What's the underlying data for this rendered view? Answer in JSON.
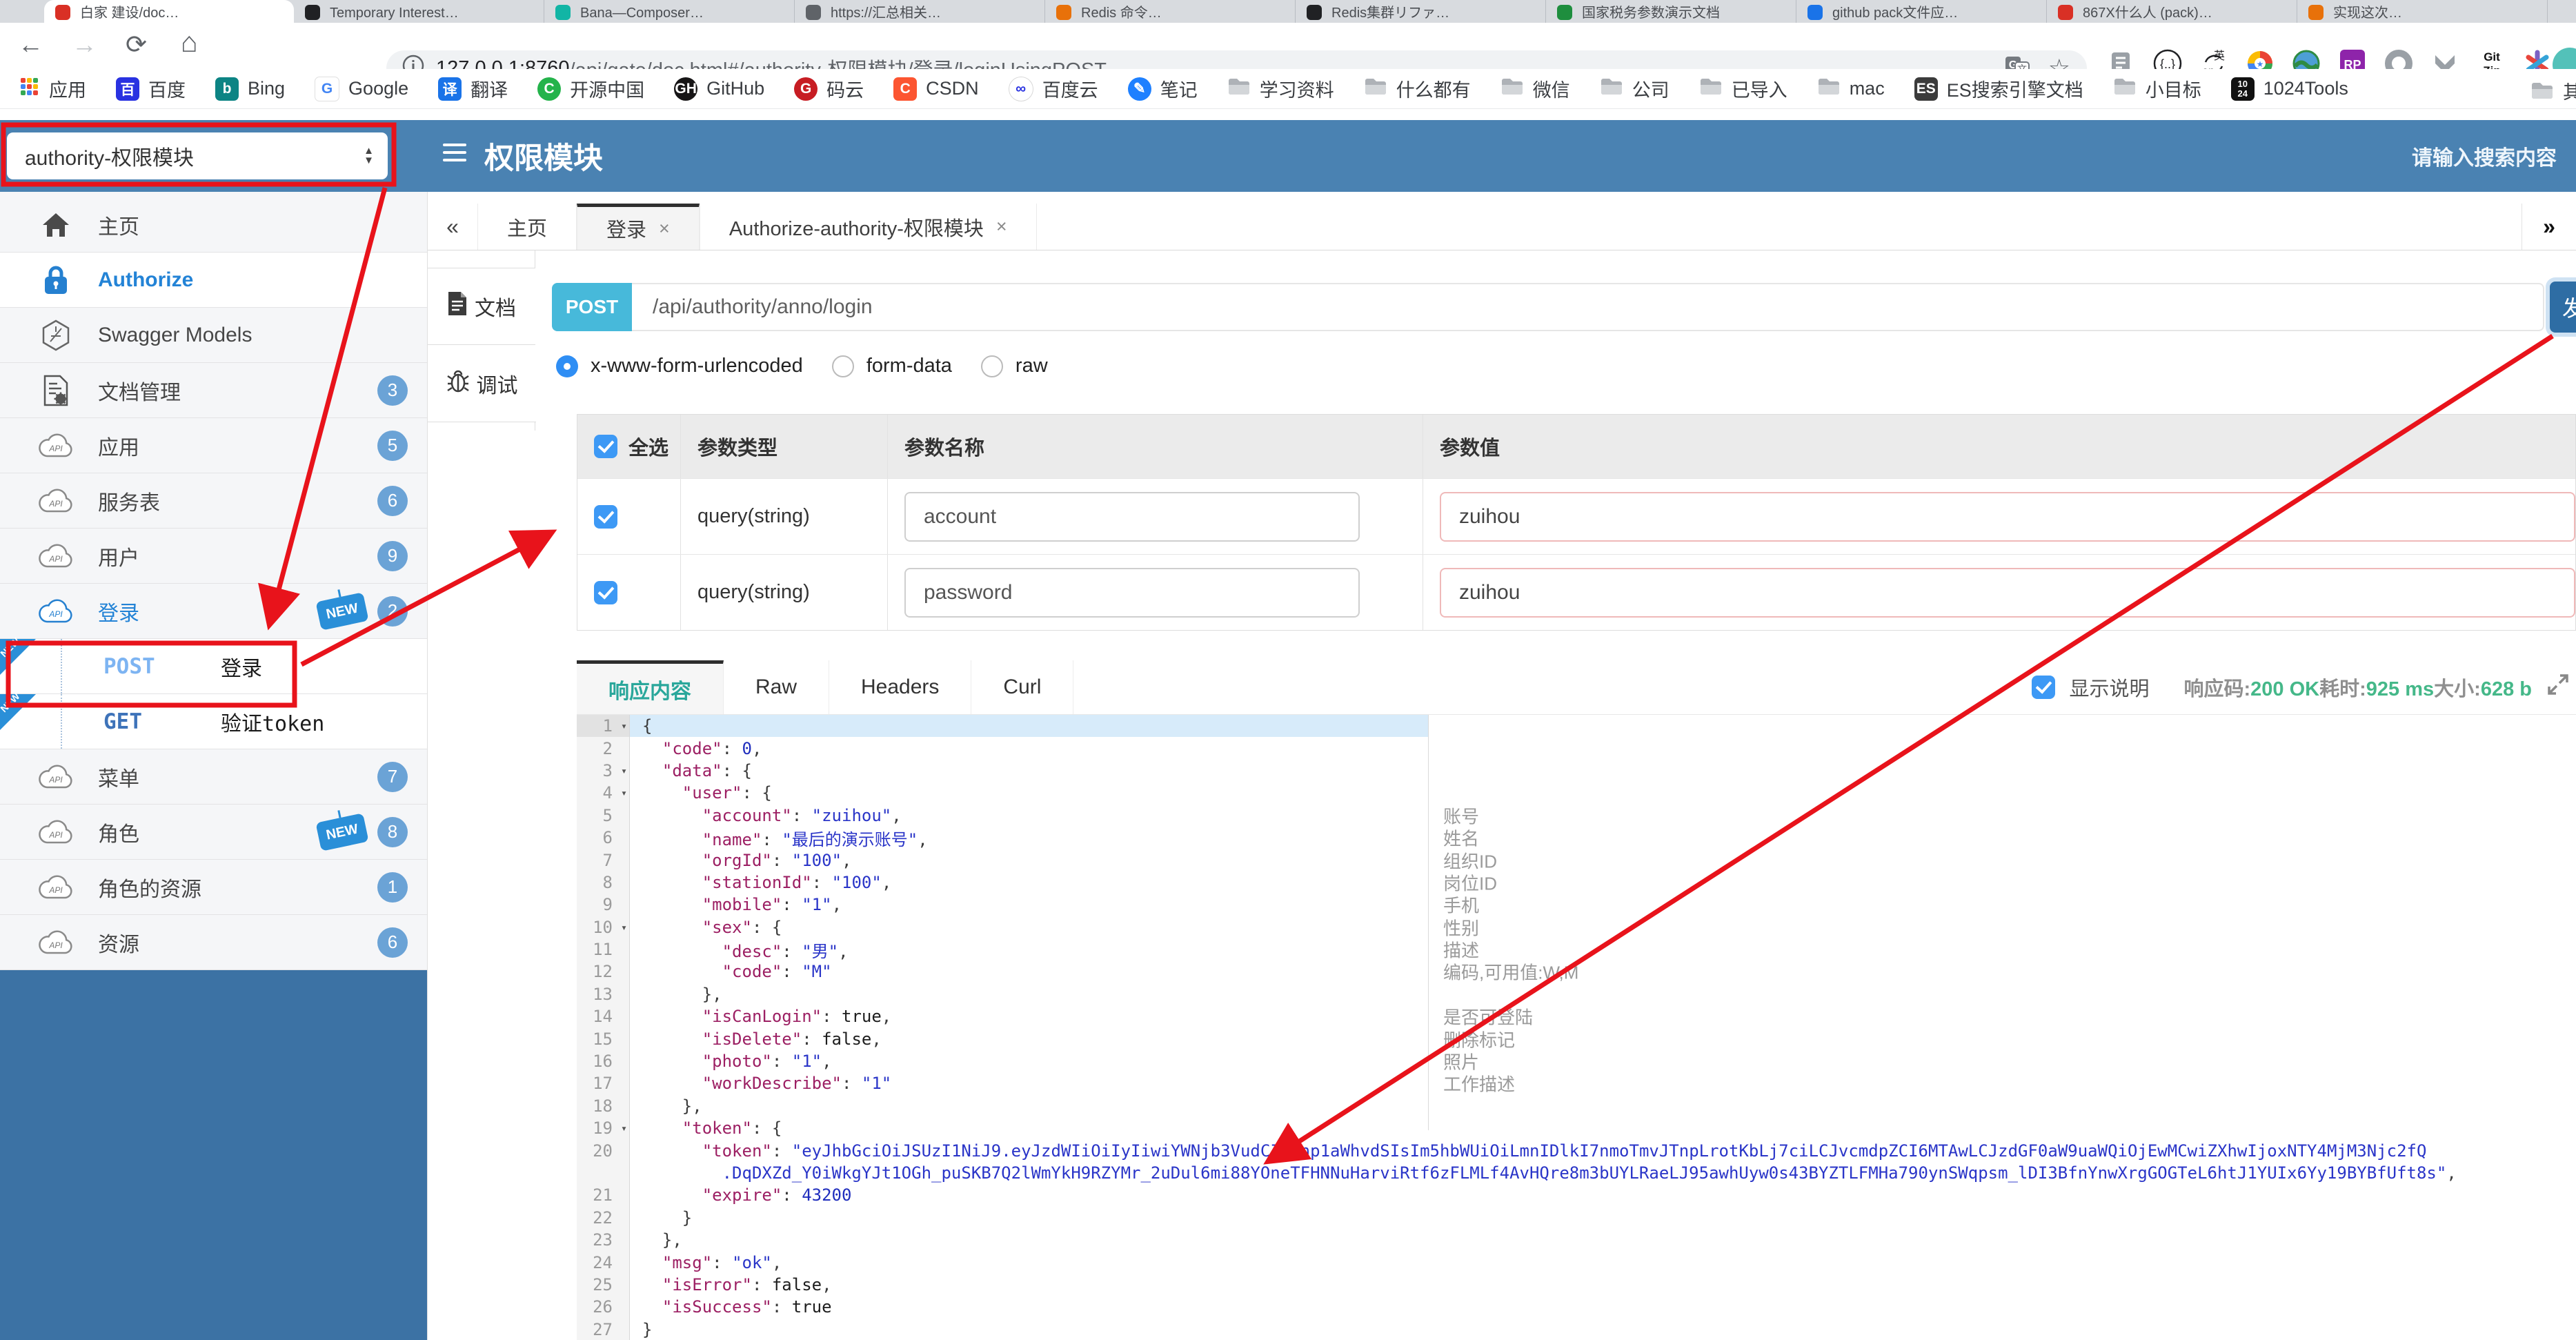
{
  "browser": {
    "tabs": [
      {
        "title": "白家 建设/doc…",
        "color": "#d93025",
        "active": true
      },
      {
        "title": "Temporary Interest…",
        "color": "#202124"
      },
      {
        "title": "Bana—Composer…",
        "color": "#12b5a5"
      },
      {
        "title": "https://汇总相关…",
        "color": "#5f6368"
      },
      {
        "title": "Redis 命令…",
        "color": "#e8710a"
      },
      {
        "title": "Redis集群リファ…",
        "color": "#202124"
      },
      {
        "title": "国家税务参数演示文档",
        "color": "#1e8e3e"
      },
      {
        "title": "github pack文件应…",
        "color": "#1a73e8"
      },
      {
        "title": "867X什么人 (pack)…",
        "color": "#d93025"
      },
      {
        "title": "实现这次…",
        "color": "#e8710a"
      }
    ],
    "nav": {
      "back": "←",
      "forward": "→",
      "reload": "⟳",
      "home": "⌂"
    },
    "url_host": "127.0.0.1:8760",
    "url_path": "/api/gate/doc.html#/authority-权限模块/登录/loginUsingPOST",
    "extensions": [
      "reader-icon",
      "braces-icon",
      "en-translate-icon",
      "colorwheel-icon",
      "globe-icon",
      "rp-icon",
      "ring-icon",
      "m-chevron-icon",
      "gitzip-icon",
      "pinwheel-icon"
    ],
    "gitzip_text": "Git Zip",
    "bookmarks": [
      {
        "label": "应用",
        "kind": "apps"
      },
      {
        "label": "百度",
        "kind": "baidu"
      },
      {
        "label": "Bing",
        "kind": "bing"
      },
      {
        "label": "Google",
        "kind": "google"
      },
      {
        "label": "翻译",
        "kind": "translate"
      },
      {
        "label": "开源中国",
        "kind": "oschina"
      },
      {
        "label": "GitHub",
        "kind": "github"
      },
      {
        "label": "码云",
        "kind": "gitee"
      },
      {
        "label": "CSDN",
        "kind": "csdn"
      },
      {
        "label": "百度云",
        "kind": "baiduyun"
      },
      {
        "label": "笔记",
        "kind": "note"
      },
      {
        "label": "学习资料",
        "kind": "folder"
      },
      {
        "label": "什么都有",
        "kind": "folder"
      },
      {
        "label": "微信",
        "kind": "folder"
      },
      {
        "label": "公司",
        "kind": "folder"
      },
      {
        "label": "已导入",
        "kind": "folder"
      },
      {
        "label": "mac",
        "kind": "folder"
      },
      {
        "label": "ES搜索引擎文档",
        "kind": "es"
      },
      {
        "label": "小目标",
        "kind": "folder"
      },
      {
        "label": "1024Tools",
        "kind": "t1024"
      }
    ],
    "bookmark_overflow": {
      "label": "其",
      "kind": "folder"
    }
  },
  "header": {
    "module": "authority-权限模块",
    "title": "权限模块",
    "search_placeholder": "请输入搜索内容"
  },
  "sidebar": {
    "items": [
      {
        "label": "主页",
        "icon": "home"
      },
      {
        "label": "Authorize",
        "icon": "lock",
        "auth": true
      },
      {
        "label": "Swagger Models",
        "icon": "hex"
      },
      {
        "label": "文档管理",
        "icon": "docgear",
        "badge": "3"
      },
      {
        "label": "应用",
        "icon": "cloud",
        "badge": "5"
      },
      {
        "label": "服务表",
        "icon": "cloud",
        "badge": "6"
      },
      {
        "label": "用户",
        "icon": "cloud",
        "badge": "9"
      },
      {
        "label": "登录",
        "icon": "cloud",
        "badge": "2",
        "new": true,
        "selected": true
      },
      {
        "child": true,
        "method": "POST",
        "label": "登录",
        "new": true
      },
      {
        "child": true,
        "method": "GET",
        "label": "验证token",
        "new": true
      },
      {
        "label": "菜单",
        "icon": "cloud",
        "badge": "7"
      },
      {
        "label": "角色",
        "icon": "cloud",
        "badge": "8",
        "new": true
      },
      {
        "label": "角色的资源",
        "icon": "cloud",
        "badge": "1"
      },
      {
        "label": "资源",
        "icon": "cloud",
        "badge": "6"
      }
    ],
    "new_tag": "NEW"
  },
  "tabs": {
    "collapse": "«",
    "expand": "»",
    "items": [
      {
        "label": "主页"
      },
      {
        "label": "登录",
        "close": "×",
        "active": true
      },
      {
        "label": "Authorize-authority-权限模块",
        "close": "×"
      }
    ]
  },
  "doc_tabs": [
    {
      "label": "文档",
      "icon": "doc"
    },
    {
      "label": "调试",
      "icon": "bug",
      "active": true
    }
  ],
  "request": {
    "method": "POST",
    "url": "/api/authority/anno/login",
    "send_label": "发",
    "content_types": [
      {
        "label": "x-www-form-urlencoded",
        "selected": true
      },
      {
        "label": "form-data",
        "selected": false
      },
      {
        "label": "raw",
        "selected": false
      }
    ]
  },
  "params": {
    "select_all": "全选",
    "headers": [
      "参数类型",
      "参数名称",
      "参数值"
    ],
    "rows": [
      {
        "checked": true,
        "type": "query(string)",
        "name": "account",
        "value": "zuihou"
      },
      {
        "checked": true,
        "type": "query(string)",
        "name": "password",
        "value": "zuihou"
      }
    ]
  },
  "response": {
    "tabs": [
      {
        "label": "响应内容",
        "active": true
      },
      {
        "label": "Raw"
      },
      {
        "label": "Headers"
      },
      {
        "label": "Curl"
      }
    ],
    "show_desc": "显示说明",
    "status": [
      {
        "label": "响应码:",
        "value": "200 OK"
      },
      {
        "label": "耗时:",
        "value": "925 ms"
      },
      {
        "label": "大小:",
        "value": "628 b"
      }
    ],
    "code_lines": [
      {
        "num": "1",
        "ind": 0,
        "fold": true,
        "hl": true,
        "tokens": [
          [
            "p",
            "{"
          ]
        ]
      },
      {
        "num": "2",
        "ind": 2,
        "tokens": [
          [
            "k",
            "\"code\""
          ],
          [
            "p",
            ": "
          ],
          [
            "n",
            "0"
          ],
          [
            "p",
            ","
          ]
        ]
      },
      {
        "num": "3",
        "ind": 2,
        "fold": true,
        "tokens": [
          [
            "k",
            "\"data\""
          ],
          [
            "p",
            ": {"
          ]
        ]
      },
      {
        "num": "4",
        "ind": 4,
        "fold": true,
        "tokens": [
          [
            "k",
            "\"user\""
          ],
          [
            "p",
            ": {"
          ]
        ]
      },
      {
        "num": "5",
        "ind": 6,
        "note": "账号",
        "tokens": [
          [
            "k",
            "\"account\""
          ],
          [
            "p",
            ": "
          ],
          [
            "s",
            "\"zuihou\""
          ],
          [
            "p",
            ","
          ]
        ]
      },
      {
        "num": "6",
        "ind": 6,
        "note": "姓名",
        "tokens": [
          [
            "k",
            "\"name\""
          ],
          [
            "p",
            ": "
          ],
          [
            "s",
            "\"最后的演示账号\""
          ],
          [
            "p",
            ","
          ]
        ]
      },
      {
        "num": "7",
        "ind": 6,
        "note": "组织ID",
        "tokens": [
          [
            "k",
            "\"orgId\""
          ],
          [
            "p",
            ": "
          ],
          [
            "s",
            "\"100\""
          ],
          [
            "p",
            ","
          ]
        ]
      },
      {
        "num": "8",
        "ind": 6,
        "note": "岗位ID",
        "tokens": [
          [
            "k",
            "\"stationId\""
          ],
          [
            "p",
            ": "
          ],
          [
            "s",
            "\"100\""
          ],
          [
            "p",
            ","
          ]
        ]
      },
      {
        "num": "9",
        "ind": 6,
        "note": "手机",
        "tokens": [
          [
            "k",
            "\"mobile\""
          ],
          [
            "p",
            ": "
          ],
          [
            "s",
            "\"1\""
          ],
          [
            "p",
            ","
          ]
        ]
      },
      {
        "num": "10",
        "ind": 6,
        "fold": true,
        "note": "性别",
        "tokens": [
          [
            "k",
            "\"sex\""
          ],
          [
            "p",
            ": {"
          ]
        ]
      },
      {
        "num": "11",
        "ind": 8,
        "note": "描述",
        "tokens": [
          [
            "k",
            "\"desc\""
          ],
          [
            "p",
            ": "
          ],
          [
            "s",
            "\"男\""
          ],
          [
            "p",
            ","
          ]
        ]
      },
      {
        "num": "12",
        "ind": 8,
        "note": "编码,可用值:W,M",
        "tokens": [
          [
            "k",
            "\"code\""
          ],
          [
            "p",
            ": "
          ],
          [
            "s",
            "\"M\""
          ]
        ]
      },
      {
        "num": "13",
        "ind": 6,
        "tokens": [
          [
            "p",
            "},"
          ]
        ]
      },
      {
        "num": "14",
        "ind": 6,
        "note": "是否可登陆",
        "tokens": [
          [
            "k",
            "\"isCanLogin\""
          ],
          [
            "p",
            ": "
          ],
          [
            "b",
            "true"
          ],
          [
            "p",
            ","
          ]
        ]
      },
      {
        "num": "15",
        "ind": 6,
        "note": "删除标记",
        "tokens": [
          [
            "k",
            "\"isDelete\""
          ],
          [
            "p",
            ": "
          ],
          [
            "b",
            "false"
          ],
          [
            "p",
            ","
          ]
        ]
      },
      {
        "num": "16",
        "ind": 6,
        "note": "照片",
        "tokens": [
          [
            "k",
            "\"photo\""
          ],
          [
            "p",
            ": "
          ],
          [
            "s",
            "\"1\""
          ],
          [
            "p",
            ","
          ]
        ]
      },
      {
        "num": "17",
        "ind": 6,
        "note": "工作描述",
        "tokens": [
          [
            "k",
            "\"workDescribe\""
          ],
          [
            "p",
            ": "
          ],
          [
            "s",
            "\"1\""
          ]
        ]
      },
      {
        "num": "18",
        "ind": 4,
        "tokens": [
          [
            "p",
            "},"
          ]
        ]
      },
      {
        "num": "19",
        "ind": 4,
        "fold": true,
        "tokens": [
          [
            "k",
            "\"token\""
          ],
          [
            "p",
            ": {"
          ]
        ]
      },
      {
        "num": "20",
        "ind": 6,
        "tokens": [
          [
            "k",
            "\"token\""
          ],
          [
            "p",
            ": "
          ],
          [
            "s",
            "\"eyJhbGciOiJSUzI1NiJ9.eyJzdWIiOiIyIiwiYWNjb3VudCI6Inp1aWhvdSIsIm5hbWUiOiLmnIDlkI7nmoTmvJTnpLrotKbLj7ciLCJvcmdpZCI6MTAwLCJzdGF0aW9uaWQiOjEwMCwiZXhwIjoxNTY4MjM3Njc2fQ"
          ]
        ]
      },
      {
        "num": "",
        "ind": 8,
        "tokens": [
          [
            "s",
            ".DqDXZd_Y0iWkgYJt1OGh_puSKB7Q2lWmYkH9RZYMr_2uDul6mi88YOneTFHNNuHarviRtf6zFLMLf4AvHQre8m3bUYLRaeLJ95awhUyw0s43BYZTLFMHa790ynSWqpsm_lDI3BfnYnwXrgGOGTeL6htJ1YUIx6Yy19BYBfUft8s\""
          ],
          [
            "p",
            ","
          ]
        ]
      },
      {
        "num": "21",
        "ind": 6,
        "tokens": [
          [
            "k",
            "\"expire\""
          ],
          [
            "p",
            ": "
          ],
          [
            "n",
            "43200"
          ]
        ]
      },
      {
        "num": "22",
        "ind": 4,
        "tokens": [
          [
            "p",
            "}"
          ]
        ]
      },
      {
        "num": "23",
        "ind": 2,
        "tokens": [
          [
            "p",
            "},"
          ]
        ]
      },
      {
        "num": "24",
        "ind": 2,
        "tokens": [
          [
            "k",
            "\"msg\""
          ],
          [
            "p",
            ": "
          ],
          [
            "s",
            "\"ok\""
          ],
          [
            "p",
            ","
          ]
        ]
      },
      {
        "num": "25",
        "ind": 2,
        "tokens": [
          [
            "k",
            "\"isError\""
          ],
          [
            "p",
            ": "
          ],
          [
            "b",
            "false"
          ],
          [
            "p",
            ","
          ]
        ]
      },
      {
        "num": "26",
        "ind": 2,
        "tokens": [
          [
            "k",
            "\"isSuccess\""
          ],
          [
            "p",
            ": "
          ],
          [
            "b",
            "true"
          ]
        ]
      },
      {
        "num": "27",
        "ind": 0,
        "tokens": [
          [
            "p",
            "}"
          ]
        ]
      }
    ]
  },
  "annotation": {
    "color": "#e8131b"
  }
}
